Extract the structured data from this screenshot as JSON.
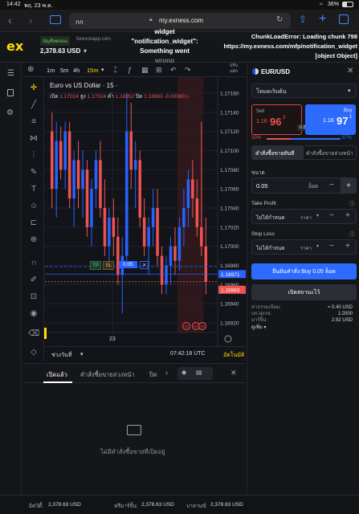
{
  "status_bar": {
    "time": "14:42",
    "date": "พฤ. 23 พ.ค.",
    "battery": "36%"
  },
  "browser": {
    "tab_text": "กก",
    "url": "my.exness.com",
    "lock_icon": "lock-icon"
  },
  "header": {
    "logo": "ex",
    "account_type": "บัญชีทดลอง",
    "account_server": "forexonapp.com",
    "balance": "2,378.63 USD",
    "error_line1": "widget",
    "error_line2": "\"notification_widget\":",
    "error_line3": "Something went",
    "error_line4": "wrong",
    "chunk_error_1": "ChunkLoadError: Loading chunk 798",
    "chunk_error_2": "https://my.exness.com/mfp/notification_widget",
    "chunk_error_3": "[object Object]"
  },
  "chart_toolbar": {
    "tf_1m": "1m",
    "tf_5m": "5m",
    "tf_4h": "4h",
    "tf_15m": "15m",
    "extra": "ปรับ\nแต่ง"
  },
  "chart": {
    "title": "Euro vs US Dollar · 15 ·",
    "ohlc_open_label": "เปิด",
    "ohlc_open": "1.17024",
    "ohlc_high_label": "สูง",
    "ohlc_high": "1.17024",
    "ohlc_low_label": "ต่ำ",
    "ohlc_low": "1.16952",
    "ohlc_close_label": "ปิด",
    "ohlc_close": "1.16963",
    "ohlc_change": "-0.00060 (-",
    "price_ticks": [
      "1.17160",
      "1.17140",
      "1.17120",
      "1.17100",
      "1.17080",
      "1.17060",
      "1.17040",
      "1.17020",
      "1.17000",
      "1.16980",
      "1.16960",
      "1.16940",
      "1.16920"
    ],
    "ask_price": "1.16971",
    "bid_price": "1.16963",
    "time_label": "23",
    "clock": "07:42:18 UTC",
    "auto": "อัตโนมัติ",
    "date_range": "ช่วงวันที่",
    "position_tp": "TP",
    "position_sl": "SL",
    "position_lot": "0.05",
    "event_markers": [
      "!!!",
      "!!!",
      "!!!"
    ]
  },
  "chart_data": {
    "type": "candlestick",
    "title": "Euro vs US Dollar · 15",
    "ylim": [
      1.1691,
      1.1717
    ],
    "candles": [
      {
        "o": 1.1712,
        "h": 1.1714,
        "l": 1.1704,
        "c": 1.1706,
        "up": false
      },
      {
        "o": 1.1706,
        "h": 1.1713,
        "l": 1.1703,
        "c": 1.1711,
        "up": true
      },
      {
        "o": 1.1711,
        "h": 1.17125,
        "l": 1.1707,
        "c": 1.1708,
        "up": false
      },
      {
        "o": 1.1708,
        "h": 1.1713,
        "l": 1.1706,
        "c": 1.1712,
        "up": true
      },
      {
        "o": 1.1712,
        "h": 1.1713,
        "l": 1.1704,
        "c": 1.1705,
        "up": false
      },
      {
        "o": 1.1705,
        "h": 1.171,
        "l": 1.1702,
        "c": 1.1709,
        "up": true
      },
      {
        "o": 1.1709,
        "h": 1.1711,
        "l": 1.1704,
        "c": 1.1706,
        "up": false
      },
      {
        "o": 1.1706,
        "h": 1.171,
        "l": 1.1703,
        "c": 1.1708,
        "up": true
      },
      {
        "o": 1.1708,
        "h": 1.1709,
        "l": 1.1701,
        "c": 1.1702,
        "up": false
      },
      {
        "o": 1.1702,
        "h": 1.1707,
        "l": 1.17,
        "c": 1.1706,
        "up": true
      },
      {
        "o": 1.1706,
        "h": 1.171,
        "l": 1.1704,
        "c": 1.1709,
        "up": true
      },
      {
        "o": 1.1709,
        "h": 1.1711,
        "l": 1.1703,
        "c": 1.1704,
        "up": false
      },
      {
        "o": 1.1704,
        "h": 1.1707,
        "l": 1.1699,
        "c": 1.17,
        "up": false
      },
      {
        "o": 1.17,
        "h": 1.1704,
        "l": 1.1698,
        "c": 1.1703,
        "up": true
      },
      {
        "o": 1.1703,
        "h": 1.1705,
        "l": 1.1699,
        "c": 1.1701,
        "up": false
      },
      {
        "o": 1.1701,
        "h": 1.1703,
        "l": 1.1696,
        "c": 1.1697,
        "up": false
      },
      {
        "o": 1.1697,
        "h": 1.1701,
        "l": 1.1693,
        "c": 1.1699,
        "up": true
      },
      {
        "o": 1.1699,
        "h": 1.1716,
        "l": 1.1698,
        "c": 1.1712,
        "up": true
      },
      {
        "o": 1.1712,
        "h": 1.1715,
        "l": 1.1706,
        "c": 1.1708,
        "up": false
      },
      {
        "o": 1.1708,
        "h": 1.1711,
        "l": 1.1704,
        "c": 1.1709,
        "up": true
      },
      {
        "o": 1.1709,
        "h": 1.171,
        "l": 1.1702,
        "c": 1.1703,
        "up": false
      },
      {
        "o": 1.1703,
        "h": 1.1705,
        "l": 1.1699,
        "c": 1.17,
        "up": false
      },
      {
        "o": 1.17,
        "h": 1.1703,
        "l": 1.1697,
        "c": 1.1702,
        "up": true
      },
      {
        "o": 1.1702,
        "h": 1.1706,
        "l": 1.17,
        "c": 1.1704,
        "up": true
      },
      {
        "o": 1.1704,
        "h": 1.1706,
        "l": 1.1698,
        "c": 1.1699,
        "up": false
      },
      {
        "o": 1.1699,
        "h": 1.17,
        "l": 1.1695,
        "c": 1.1696,
        "up": false
      },
      {
        "o": 1.1696,
        "h": 1.1699,
        "l": 1.1695,
        "c": 1.1698,
        "up": true
      },
      {
        "o": 1.1698,
        "h": 1.1701,
        "l": 1.1696,
        "c": 1.17,
        "up": true
      },
      {
        "o": 1.17,
        "h": 1.1702,
        "l": 1.1697,
        "c": 1.16985,
        "up": false
      },
      {
        "o": 1.16985,
        "h": 1.1703,
        "l": 1.16975,
        "c": 1.1702,
        "up": true
      },
      {
        "o": 1.1702,
        "h": 1.1706,
        "l": 1.17,
        "c": 1.1704,
        "up": true
      },
      {
        "o": 1.1704,
        "h": 1.1708,
        "l": 1.1702,
        "c": 1.1707,
        "up": true
      },
      {
        "o": 1.1707,
        "h": 1.1709,
        "l": 1.1703,
        "c": 1.1705,
        "up": false
      },
      {
        "o": 1.1705,
        "h": 1.1707,
        "l": 1.1701,
        "c": 1.1702,
        "up": false
      },
      {
        "o": 1.1702,
        "h": 1.1713,
        "l": 1.1699,
        "c": 1.17,
        "up": false
      },
      {
        "o": 1.17,
        "h": 1.1703,
        "l": 1.1695,
        "c": 1.16963,
        "up": false
      }
    ]
  },
  "bottom_panel": {
    "tab_open": "เปิดแล้ว",
    "tab_pending": "คำสั่งซื้อขายล่วงหน้า",
    "tab_closed": "ปิด",
    "empty_text": "ไม่มีคำสั่งซื้อขายที่เปิดอยู่"
  },
  "footer": {
    "equity_label": "อิควิตี้:",
    "equity": "2,378.63 USD",
    "free_margin_label": "ฟรีมาร์จิ้น:",
    "free_margin": "2,378.63 USD",
    "balance_label": "บาลานซ์:",
    "balance": "2,378.63 USD"
  },
  "order_panel": {
    "symbol": "EUR/USD",
    "mode": "โหมดเริ่มต้น",
    "sell_label": "Sell",
    "sell_price_small": "1.16",
    "sell_price_big": "96",
    "sell_price_sup": "3",
    "buy_label": "Buy",
    "buy_price_small": "1.16",
    "buy_price_big": "97",
    "buy_price_sup": "1",
    "spread": "0.8",
    "sell_pct": "33%",
    "buy_pct": "67%",
    "sell_pct_value": 0.33,
    "tab_market": "คำสั่งซื้อขายทันที",
    "tab_pending": "คำสั่งซื้อขายล่วงหน้า",
    "volume_label": "ขนาด",
    "volume": "0.05",
    "volume_unit": "ล็อต",
    "tp_label": "Take Profit",
    "tp_value": "ไม่ได้กำหนด",
    "tp_unit": "ราคา",
    "sl_label": "Stop Loss",
    "sl_value": "ไม่ได้กำหนด",
    "sl_unit": "ราคา",
    "confirm_button": "ยืนยันคำสั่ง Buy 0.05 ล็อต",
    "advanced_button": "เปิดสถานะไว้",
    "fee_label": "ค่าธรรมเนียม:",
    "fee_value": "≈ 0.40 USD",
    "leverage_label": "เลเวอเรจ:",
    "leverage_value": "1:2000",
    "margin_label": "มาร์จิ้น:",
    "margin_value": "2.92 USD",
    "more": "ดูเพิ่ม"
  }
}
